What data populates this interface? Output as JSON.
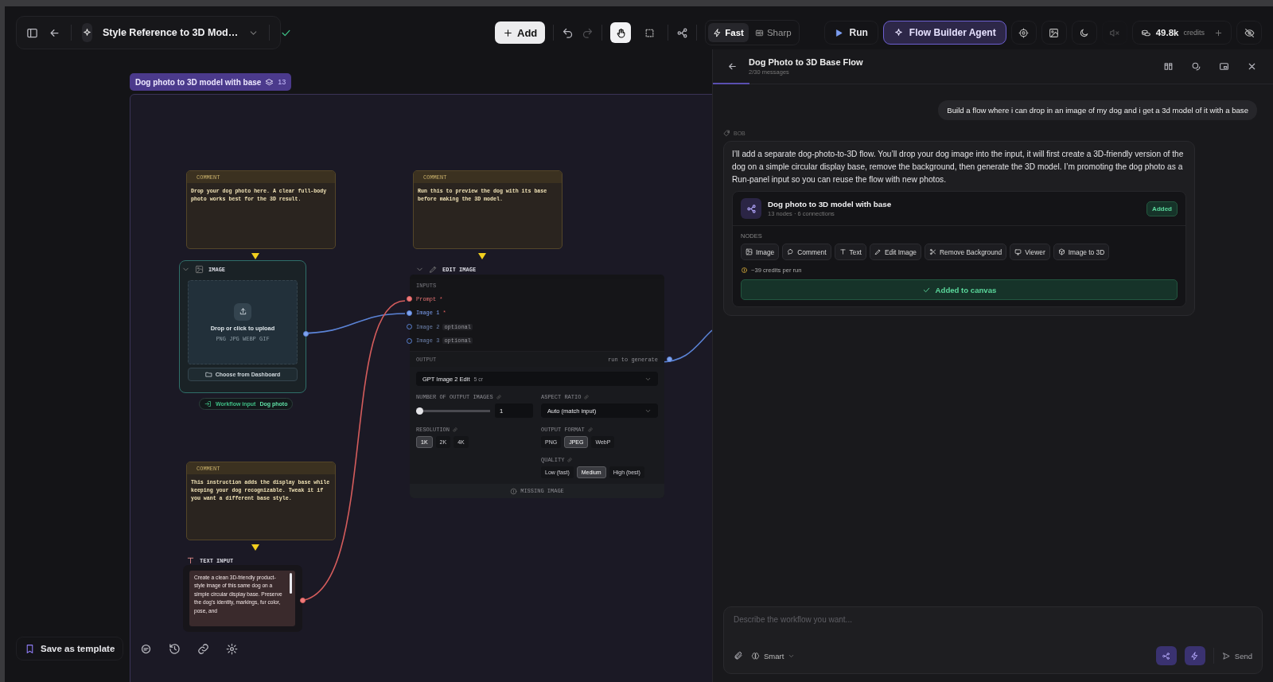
{
  "topbar": {
    "title": "Style Reference to 3D Mod…",
    "saved": true
  },
  "toolbar": {
    "add": "Add",
    "history": [
      {
        "kind": "undo",
        "disabled": false
      },
      {
        "kind": "redo",
        "disabled": true
      }
    ],
    "tools": [
      {
        "kind": "pan",
        "selected": true
      },
      {
        "kind": "select",
        "selected": false
      }
    ],
    "modes": [
      {
        "kind": "fast",
        "label": "Fast",
        "selected": true
      },
      {
        "kind": "sharp",
        "label": "Sharp",
        "selected": false
      }
    ]
  },
  "actions": {
    "run": "Run",
    "agent": "Flow Builder Agent",
    "icons": [
      {
        "kind": "target",
        "disabled": false
      },
      {
        "kind": "image",
        "disabled": false
      },
      {
        "kind": "moon",
        "disabled": false
      },
      {
        "kind": "mute",
        "disabled": true
      }
    ],
    "credits": {
      "value": "49.8k",
      "label": "credits"
    }
  },
  "group": {
    "title": "Dog photo to 3D model with base",
    "count": "13"
  },
  "comments": [
    {
      "label": "COMMENT",
      "text": "Drop your dog photo here. A clear full-body photo works best for the 3D result."
    },
    {
      "label": "COMMENT",
      "text": "Run this to preview the dog with its base before making the 3D model."
    },
    {
      "label": "COMMENT",
      "text": "This instruction adds the display base while keeping your dog recognizable. Tweak it if you want a different base style."
    }
  ],
  "image_node": {
    "title": "IMAGE",
    "upload": "Drop or click to upload",
    "formats": "PNG JPG WEBP GIF",
    "dashboard": "Choose from Dashboard",
    "workflow_input": {
      "label": "Workflow input",
      "value": "Dog photo"
    }
  },
  "edit_image": {
    "title": "EDIT IMAGE",
    "inputs_label": "INPUTS",
    "inputs": [
      {
        "name": "Prompt",
        "marker": "*",
        "kind": "text",
        "connected": true
      },
      {
        "name": "Image 1",
        "marker": "*",
        "kind": "image",
        "connected": true
      },
      {
        "name": "Image 2",
        "tag": "optional",
        "kind": "image",
        "connected": false
      },
      {
        "name": "Image 3",
        "tag": "optional",
        "kind": "image",
        "connected": false
      }
    ],
    "output_label": "OUTPUT",
    "output_hint": "run to generate",
    "model": "GPT Image 2 Edit",
    "model_cost": "5 cr",
    "count": {
      "label": "NUMBER OF OUTPUT IMAGES",
      "level": 0,
      "value": "1"
    },
    "aspect": {
      "label": "ASPECT RATIO",
      "value": "Auto (match input)"
    },
    "resolution": {
      "label": "RESOLUTION",
      "options": [
        {
          "label": "1K",
          "selected": true
        },
        {
          "label": "2K",
          "selected": false
        },
        {
          "label": "4K",
          "selected": false
        }
      ]
    },
    "format": {
      "label": "OUTPUT FORMAT",
      "options": [
        {
          "label": "PNG",
          "selected": false
        },
        {
          "label": "JPEG",
          "selected": true
        },
        {
          "label": "WebP",
          "selected": false
        }
      ]
    },
    "quality": {
      "label": "QUALITY",
      "options": [
        {
          "label": "Low (fast)",
          "selected": false
        },
        {
          "label": "Medium",
          "selected": true
        },
        {
          "label": "High (best)",
          "selected": false
        }
      ]
    },
    "status": "MISSING IMAGE"
  },
  "text_input": {
    "title": "TEXT INPUT",
    "value": "Create a clean 3D-friendly product-style image of this same dog on a simple circular display base. Preserve the dog’s identity, markings, fur color, pose, and"
  },
  "bottom_bar": {
    "save": "Save as template"
  },
  "chat": {
    "title": "Dog Photo to 3D Base Flow",
    "subtitle": "2/30 messages",
    "messages": [
      {
        "kind": "user",
        "text": "Build a flow where i can drop in an image of my dog and i get a 3d model of it with a base"
      },
      {
        "kind": "reply",
        "author": "BOB",
        "text": "I’ll add a separate dog-photo-to-3D flow. You’ll drop your dog image into the input, it will first create a 3D-friendly version of the dog on a simple circular display base, remove the background, then generate the 3D model. I’m promoting the dog photo as a Run-panel input so you can reuse the flow with new photos.",
        "flow_card": {
          "title": "Dog photo to 3D model with base",
          "meta": "13 nodes · 6 connections",
          "badge": "Added",
          "nodes_label": "NODES",
          "nodes": [
            {
              "kind": "image",
              "label": "Image"
            },
            {
              "kind": "comment",
              "label": "Comment"
            },
            {
              "kind": "text",
              "label": "Text"
            },
            {
              "kind": "edit",
              "label": "Edit Image"
            },
            {
              "kind": "remove",
              "label": "Remove Background"
            },
            {
              "kind": "viewer",
              "label": "Viewer"
            },
            {
              "kind": "to3d",
              "label": "Image to 3D"
            }
          ],
          "cost": "~39 credits per run",
          "action": "Added to canvas"
        }
      }
    ]
  },
  "composer": {
    "placeholder": "Describe the workflow you want...",
    "mode": "Smart",
    "toggles": [
      {
        "kind": "flow",
        "on": true
      },
      {
        "kind": "bolt",
        "on": true
      }
    ],
    "send": {
      "label": "Send",
      "disabled": true
    }
  }
}
